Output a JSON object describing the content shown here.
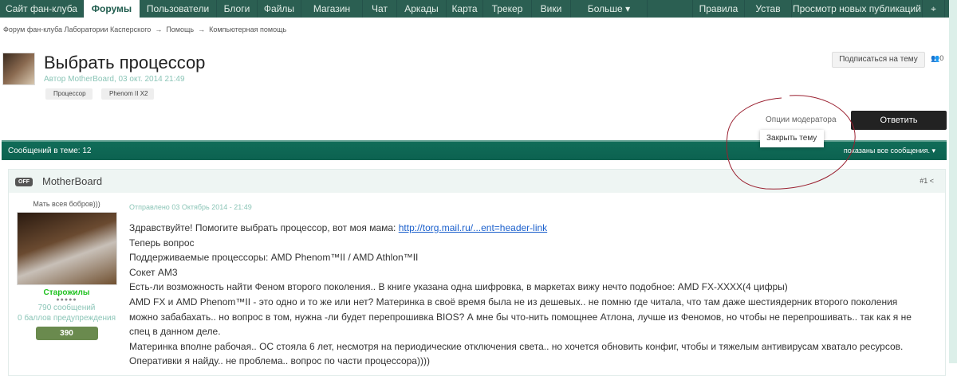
{
  "nav": {
    "items": [
      "Сайт фан-клуба",
      "Форумы",
      "Пользователи",
      "Блоги",
      "Файлы",
      "Магазин",
      "Чат",
      "Аркады",
      "Карта",
      "Трекер",
      "Вики",
      "Больше ▾"
    ],
    "right": [
      "Правила",
      "Устав",
      "Просмотр новых публикаций"
    ],
    "pin_icon": "map-pin-icon"
  },
  "breadcrumb": [
    "Форум фан-клуба Лаборатории Касперского",
    "→",
    "Помощь",
    "→",
    "Компьютерная помощь"
  ],
  "topic": {
    "title": "Выбрать процессор",
    "author": "Автор MotherBoard, 03 окт. 2014 21:49",
    "tags": [
      "Процессор",
      "Phenom II X2"
    ],
    "subscribe": "Подписаться на тему",
    "followers": "0"
  },
  "mod": {
    "options": "Опции модератора",
    "close": "Закрыть тему",
    "reply": "Ответить"
  },
  "bar": {
    "count": "Сообщений в теме: 12",
    "filter": "показаны все сообщения. ▾"
  },
  "post": {
    "status": "OFF",
    "name": "MotherBoard",
    "num": "#1",
    "user_title": "Мать всея бобров)))",
    "group": "Старожилы",
    "pips": "●●●●●",
    "posts": "790 сообщений",
    "warn": "0 баллов предупреждения",
    "rep": "390",
    "sent": "Отправлено 03 Октябрь 2014 - 21:49",
    "line1": "Здравствуйте! Помогите выбрать процессор, вот моя мама: ",
    "link": "http://torg.mail.ru/...ent=header-link",
    "lines": [
      "Теперь вопрос",
      "Поддерживаемые процессоры: AMD Phenom™II / AMD Athlon™II",
      "Сокет AM3",
      "Есть-ли возможность найти Феном второго поколения..  В книге указана одна шифровка, в маркетах вижу нечто подобное: AMD FX-XXXX(4 цифры)",
      "AMD  FX и AMD Phenom™II - это одно и то же или нет? Материнка в своё время была не из дешевых.. не помню где читала, что там даже шестиядерник второго поколения можно забабахать..  но вопрос в том, нужна -ли будет перепрошивка BIOS? А мне бы что-нить помощнее Атлона, лучше из Феномов, но чтобы не перепрошивать.. так как я не спец в данном деле.",
      "Материнка вполне рабочая.. ОС стояла 6 лет, несмотря на периодические отключения света..  но хочется обновить конфиг, чтобы и тяжелым антивирусам хватало ресурсов.",
      "Оперативки я найду.. не проблема.. вопрос по части процессора))))"
    ]
  }
}
